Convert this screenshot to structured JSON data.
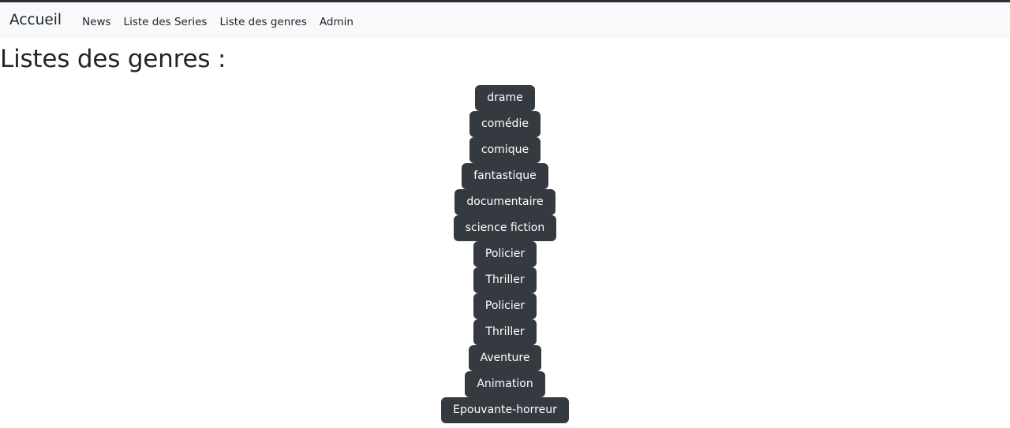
{
  "navbar": {
    "brand": "Accueil",
    "links": [
      {
        "label": "News"
      },
      {
        "label": "Liste des Series"
      },
      {
        "label": "Liste des genres"
      },
      {
        "label": "Admin"
      }
    ],
    "background_color": "#f8f9fa",
    "text_color": "#212529"
  },
  "main": {
    "title": "Listes des genres :",
    "badge_color": "#343a40",
    "badge_text_color": "#ffffff",
    "genres": [
      {
        "label": "drame"
      },
      {
        "label": "comédie"
      },
      {
        "label": "comique"
      },
      {
        "label": "fantastique"
      },
      {
        "label": "documentaire"
      },
      {
        "label": "science fiction"
      },
      {
        "label": "Policier"
      },
      {
        "label": "Thriller"
      },
      {
        "label": "Policier"
      },
      {
        "label": "Thriller"
      },
      {
        "label": "Aventure"
      },
      {
        "label": "Animation"
      },
      {
        "label": "Epouvante-horreur"
      }
    ]
  }
}
